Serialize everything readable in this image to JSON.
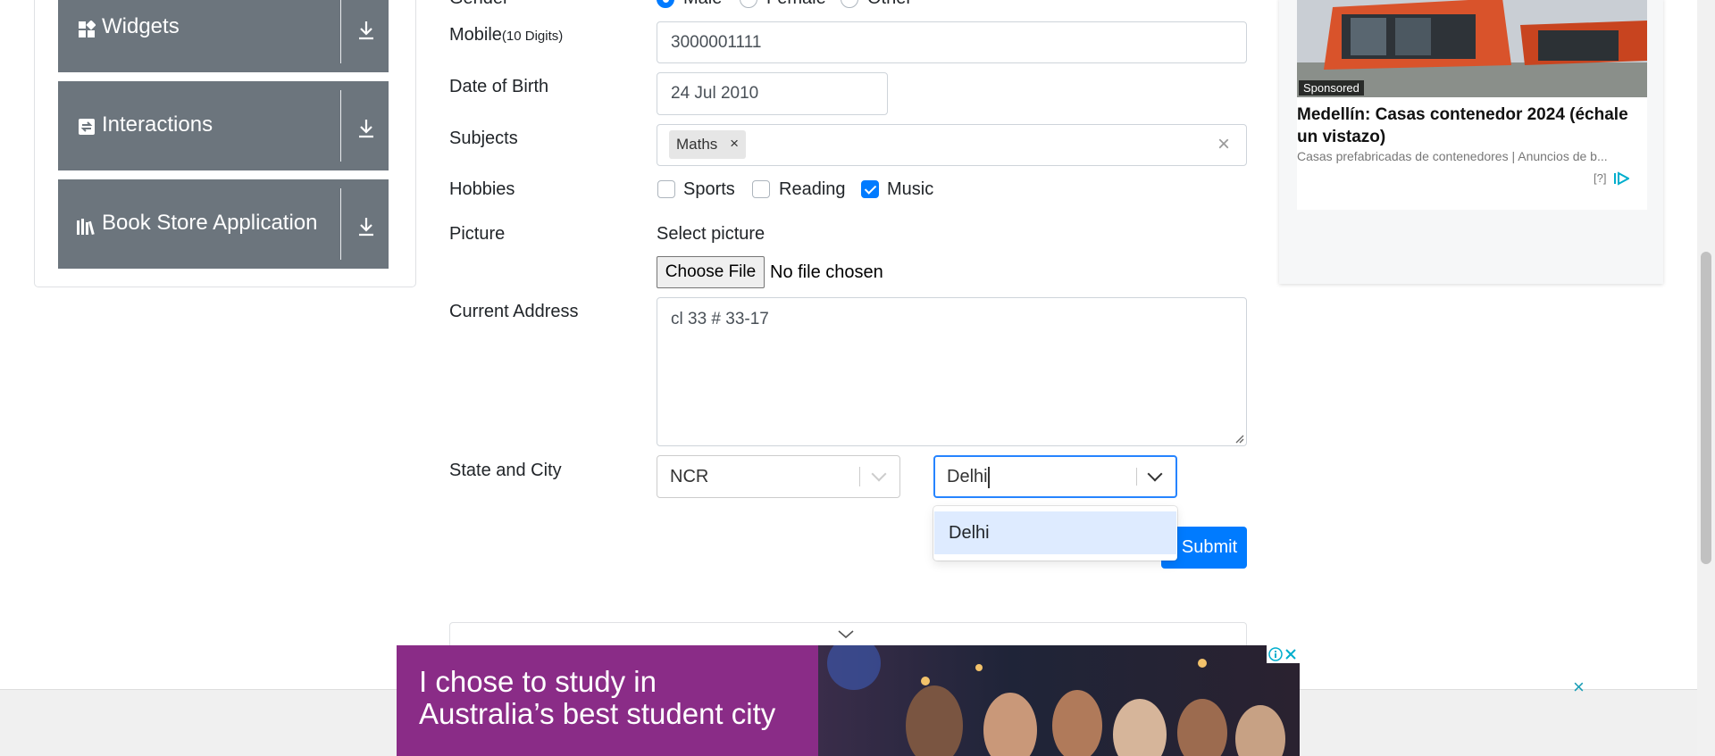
{
  "sidebar": {
    "items": [
      {
        "label": "Widgets"
      },
      {
        "label": "Interactions"
      },
      {
        "label": "Book Store Application"
      }
    ]
  },
  "form": {
    "gender": {
      "label": "Gender",
      "options": [
        {
          "label": "Male",
          "selected": true
        },
        {
          "label": "Female",
          "selected": false
        },
        {
          "label": "Other",
          "selected": false
        }
      ]
    },
    "mobile": {
      "label": "Mobile",
      "hint": "(10 Digits)",
      "value": "3000001111"
    },
    "dob": {
      "label": "Date of Birth",
      "value": "24 Jul 2010"
    },
    "subjects": {
      "label": "Subjects",
      "tags": [
        "Maths"
      ]
    },
    "hobbies": {
      "label": "Hobbies",
      "options": [
        {
          "label": "Sports",
          "checked": false
        },
        {
          "label": "Reading",
          "checked": false
        },
        {
          "label": "Music",
          "checked": true
        }
      ]
    },
    "picture": {
      "label": "Picture",
      "select_label": "Select picture",
      "button": "Choose File",
      "status": "No file chosen"
    },
    "address": {
      "label": "Current Address",
      "value": "cl 33 # 33-17"
    },
    "state_city": {
      "label": "State and City",
      "state": "NCR",
      "city_input": "Delhi",
      "city_options": [
        "Delhi"
      ]
    },
    "submit": "Submit"
  },
  "ad_top": {
    "sponsored": "Sponsored",
    "headline": "Medellín: Casas contenedor 2024 (échale un vistazo)",
    "source": "Casas prefabricadas de contenedores | Anuncios de b...",
    "info": "[?]"
  },
  "ad_bottom": {
    "line1": "I chose to study in",
    "line2": "Australia’s best student city"
  },
  "colors": {
    "primary": "#007bff",
    "sidebar": "#6c757d",
    "option_highlight": "#deebff",
    "ad_purple": "#8a2c87"
  }
}
